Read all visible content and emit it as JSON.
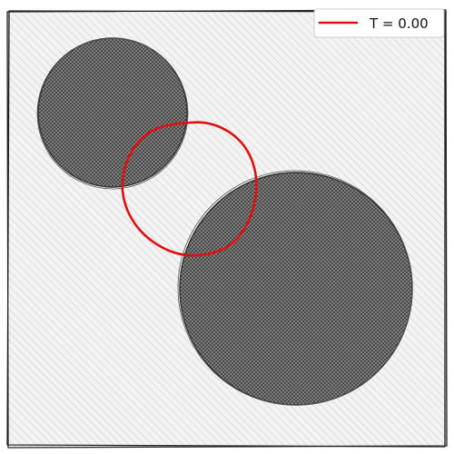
{
  "legend": {
    "label": "T = 0.00"
  },
  "colors": {
    "background": "#f2f2f2",
    "hatch_light": "#c8c8c8",
    "obstacle_fill": "#7a7a7a",
    "obstacle_hatch": "#3c3c3c",
    "contour": "#e01010",
    "frame": "#222222"
  }
}
